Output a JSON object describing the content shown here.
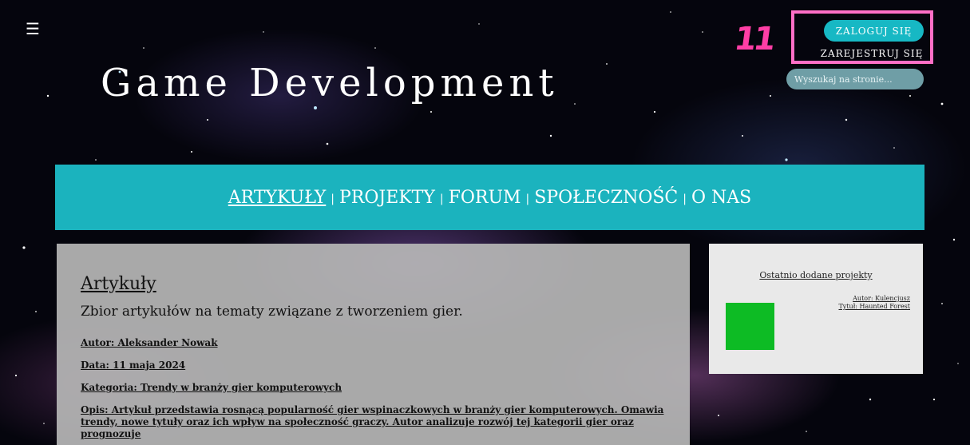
{
  "header": {
    "menu_icon": "hamburger-icon",
    "title": "Game Development",
    "annotation": "11",
    "login_label": "ZALOGUJ SIĘ",
    "register_label": "ZAREJESTRUJ SIĘ",
    "search_placeholder": "Wyszukaj na stronie..."
  },
  "nav": {
    "items": [
      "ARTYKUŁY",
      "PROJEKTY",
      "FORUM",
      "SPOŁECZNOŚĆ",
      "O NAS"
    ],
    "separator": "|"
  },
  "main": {
    "title": "Artykuły",
    "intro": "Zbior artykułów na tematy związane z tworzeniem gier.",
    "author": "Autor: Aleksander Nowak",
    "date": "Data: 11 maja 2024",
    "category": "Kategoria: Trendy w branży gier komputerowych",
    "description": "Opis: Artykuł przedstawia rosnącą popularność gier wspinaczkowych w branży gier komputerowych. Omawia trendy, nowe tytuły oraz ich wpływ na społeczność graczy. Autor analizuje rozwój tej kategorii gier oraz prognozuje"
  },
  "sidebar": {
    "title": "Ostatnio dodane projekty",
    "project_author": "Autor: Kulencjusz",
    "project_title": "Tytuł: Haunted Forest",
    "thumbnail_color": "#0dbb24"
  },
  "colors": {
    "accent": "#1bb3be",
    "highlight": "#ff6fc6"
  }
}
